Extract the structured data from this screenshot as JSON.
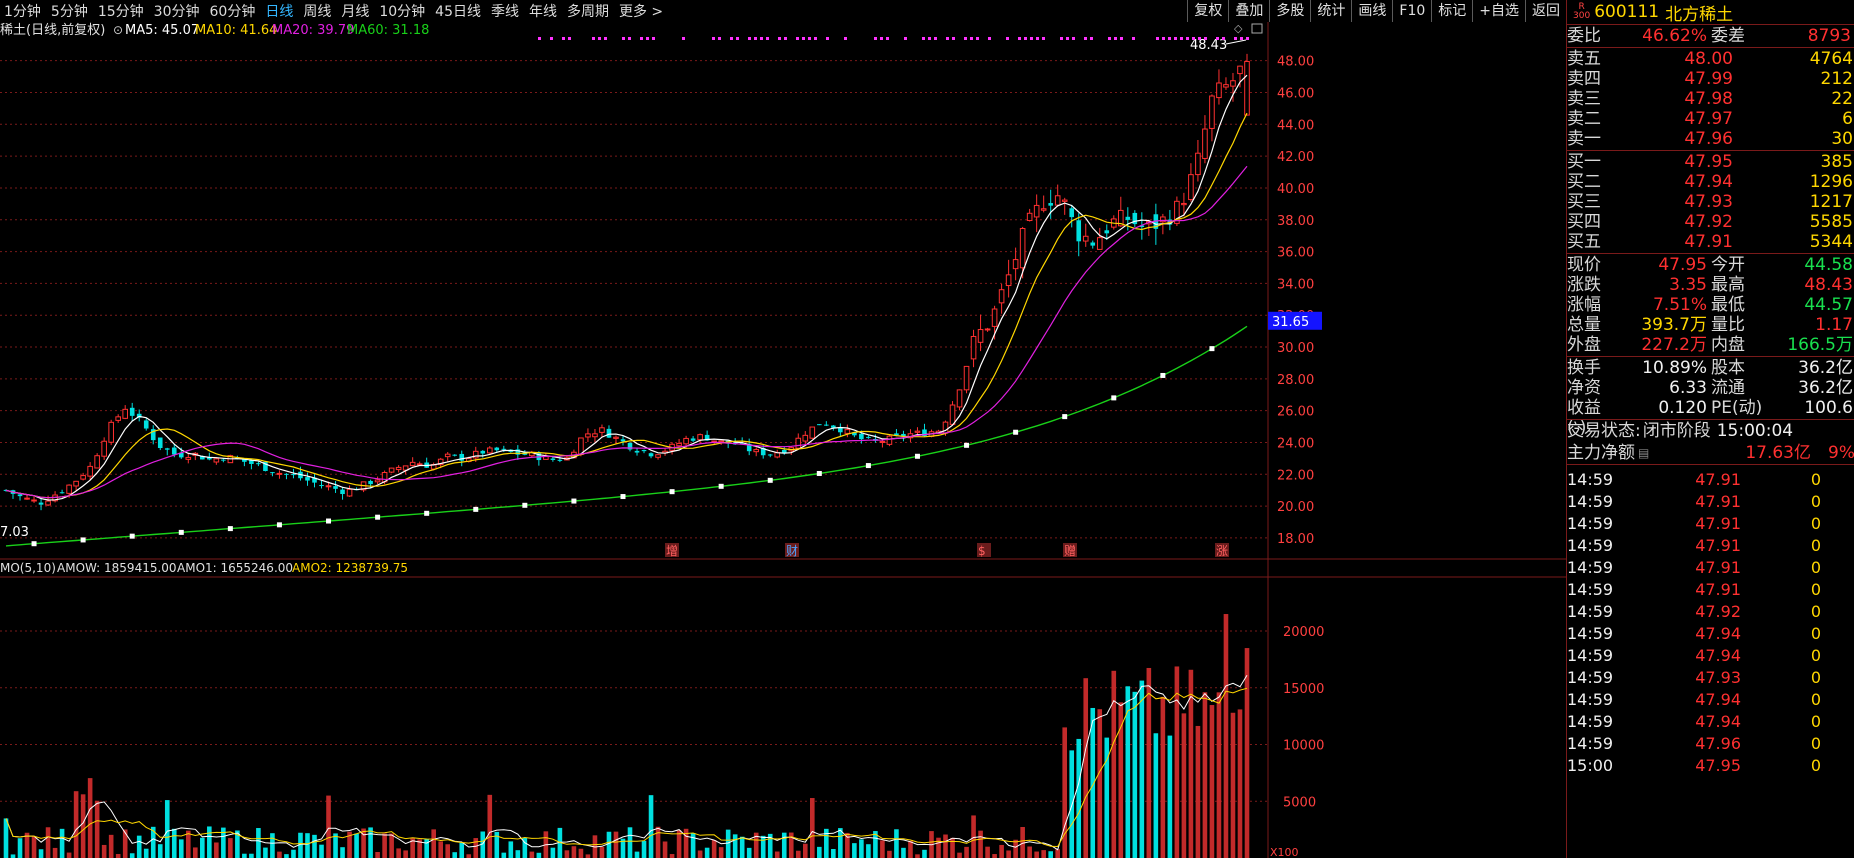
{
  "periods": [
    "1分钟",
    "5分钟",
    "15分钟",
    "30分钟",
    "60分钟",
    "日线",
    "周线",
    "月线",
    "10分钟",
    "45日线",
    "季线",
    "年线",
    "多周期",
    "更多 >"
  ],
  "active_period": "日线",
  "right_buttons": [
    "复权",
    "叠加",
    "多股",
    "统计",
    "画线",
    "F10",
    "标记",
    "+自选",
    "返回"
  ],
  "chart_title": "稀土(日线,前复权)",
  "ma": {
    "ma5": "MA5: 45.07",
    "ma10": "MA10: 41.64",
    "ma20": "MA20: 39.79",
    "ma60": "MA60: 31.18"
  },
  "colors": {
    "ma5": "#ffffff",
    "ma10": "#ffd700",
    "ma20": "#e020e0",
    "ma60": "#19d019",
    "up": "#ff3030",
    "down": "#00e0e0",
    "grid": "#7a1a1a"
  },
  "price_ticks": [
    "48.00",
    "46.00",
    "44.00",
    "42.00",
    "40.00",
    "38.00",
    "36.00",
    "34.00",
    "32.00",
    "30.00",
    "28.00",
    "26.00",
    "24.00",
    "22.00",
    "20.00",
    "18.00"
  ],
  "high_label": "48.43",
  "low_label": "7.03",
  "current_tag": "31.65",
  "event_markers": [
    "增",
    "财",
    "$",
    "赠",
    "涨"
  ],
  "volume_header": {
    "title": "MO(5,10)",
    "amow": "AMOW: 1859415.00",
    "amo1": "AMO1: 1655246.00",
    "amo2": "AMO2: 1238739.75"
  },
  "volume_ticks": [
    "20000",
    "15000",
    "10000",
    "5000",
    "X100"
  ],
  "stock": {
    "badge_top": "R",
    "badge_bottom": "300",
    "code": "600111",
    "name": "北方稀土"
  },
  "weibi": {
    "label": "委比",
    "value": "46.62%",
    "label2": "委差",
    "value2": "8793"
  },
  "asks": [
    {
      "label": "卖五",
      "price": "48.00",
      "vol": "4764"
    },
    {
      "label": "卖四",
      "price": "47.99",
      "vol": "212"
    },
    {
      "label": "卖三",
      "price": "47.98",
      "vol": "22"
    },
    {
      "label": "卖二",
      "price": "47.97",
      "vol": "6"
    },
    {
      "label": "卖一",
      "price": "47.96",
      "vol": "30"
    }
  ],
  "bids": [
    {
      "label": "买一",
      "price": "47.95",
      "vol": "385"
    },
    {
      "label": "买二",
      "price": "47.94",
      "vol": "1296"
    },
    {
      "label": "买三",
      "price": "47.93",
      "vol": "1217"
    },
    {
      "label": "买四",
      "price": "47.92",
      "vol": "5585"
    },
    {
      "label": "买五",
      "price": "47.91",
      "vol": "5344"
    }
  ],
  "quote1": [
    {
      "l1": "现价",
      "v1": "47.95",
      "l2": "今开",
      "v2": "44.58"
    },
    {
      "l1": "涨跌",
      "v1": "3.35",
      "l2": "最高",
      "v2": "48.43"
    },
    {
      "l1": "涨幅",
      "v1": "7.51%",
      "l2": "最低",
      "v2": "44.57"
    },
    {
      "l1": "总量",
      "v1": "393.7万",
      "l2": "量比",
      "v2": "1.17"
    },
    {
      "l1": "外盘",
      "v1": "227.2万",
      "l2": "内盘",
      "v2": "166.5万"
    }
  ],
  "quote2": [
    {
      "l1": "换手",
      "v1": "10.89%",
      "l2": "股本",
      "v2": "36.2亿"
    },
    {
      "l1": "净资",
      "v1": "6.33",
      "l2": "流通",
      "v2": "36.2亿"
    },
    {
      "l1": "收益(-)",
      "v1": "0.120",
      "l2": "PE(动)",
      "v2": "100.6"
    }
  ],
  "trade_status": {
    "label": "交易状态:",
    "value": "闭市阶段",
    "time": "15:00:04"
  },
  "main_flow": {
    "label": "主力净额",
    "value": "17.63亿",
    "pct": "9%"
  },
  "ticks": [
    {
      "t": "14:59",
      "p": "47.91",
      "v": "0"
    },
    {
      "t": "14:59",
      "p": "47.91",
      "v": "0"
    },
    {
      "t": "14:59",
      "p": "47.91",
      "v": "0"
    },
    {
      "t": "14:59",
      "p": "47.91",
      "v": "0"
    },
    {
      "t": "14:59",
      "p": "47.91",
      "v": "0"
    },
    {
      "t": "14:59",
      "p": "47.91",
      "v": "0"
    },
    {
      "t": "14:59",
      "p": "47.92",
      "v": "0"
    },
    {
      "t": "14:59",
      "p": "47.94",
      "v": "0"
    },
    {
      "t": "14:59",
      "p": "47.94",
      "v": "0"
    },
    {
      "t": "14:59",
      "p": "47.93",
      "v": "0"
    },
    {
      "t": "14:59",
      "p": "47.94",
      "v": "0"
    },
    {
      "t": "14:59",
      "p": "47.94",
      "v": "0"
    },
    {
      "t": "14:59",
      "p": "47.96",
      "v": "0"
    },
    {
      "t": "15:00",
      "p": "47.95",
      "v": "0"
    }
  ],
  "chart_data": {
    "type": "candlestick",
    "price_range": [
      16.8,
      49.3
    ],
    "volume_range": [
      0,
      23000
    ],
    "close_path": [
      21,
      20.5,
      20.2,
      20.8,
      21.5,
      22.5,
      24.8,
      26.2,
      25.2,
      23.8,
      23.2,
      23.3,
      22.9,
      23.1,
      22.8,
      22.5,
      22.1,
      21.9,
      21.5,
      21.2,
      20.9,
      21.3,
      21.8,
      22.4,
      22.8,
      22.5,
      23.1,
      23.0,
      23.4,
      23.5,
      23.3,
      23.2,
      22.9,
      23.0,
      24.5,
      24.8,
      24.2,
      23.6,
      23.3,
      23.6,
      24.2,
      24.4,
      24.0,
      23.9,
      23.4,
      23.3,
      23.6,
      24.6,
      25.3,
      24.9,
      24.3,
      24.0,
      24.2,
      24.5,
      24.6,
      24.8,
      27.2,
      30.5,
      31.8,
      34.5,
      37.4,
      39.2,
      39.6,
      37.2,
      36.6,
      37.8,
      38.1,
      37.4,
      37.9,
      38.8,
      41.2,
      45.8,
      46.5,
      47.95
    ]
  }
}
